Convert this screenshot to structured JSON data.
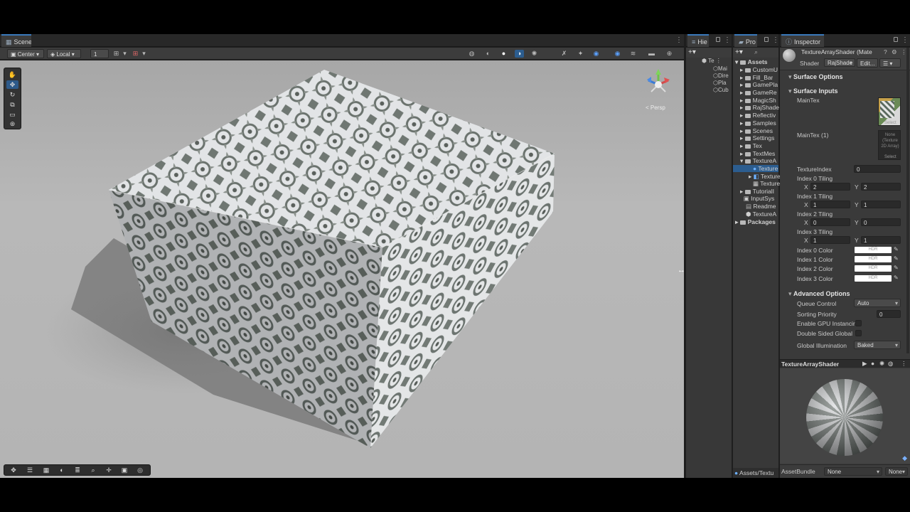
{
  "scene": {
    "tab": "Scene",
    "pivot_mode": "Center",
    "pivot_rotation": "Local",
    "grid_value": "1",
    "persp_label": "< Persp"
  },
  "hierarchy": {
    "tab": "Hie",
    "scene_name": "Te",
    "items": [
      "Mai",
      "Dire",
      "Pla",
      "Cub"
    ]
  },
  "project": {
    "tab": "Pro",
    "assets_label": "Assets",
    "folders": [
      "CustomU",
      "Fill_Bar",
      "GamePla",
      "GameRe",
      "MagicSh",
      "RajShade",
      "Reflectiv",
      "Samples",
      "Scenes",
      "Settings",
      "Tex",
      "TextMes",
      "TextureA"
    ],
    "texture_children": [
      "Texture",
      "Texture",
      "Texture"
    ],
    "more_folders": [
      "TutorialI",
      "InputSys"
    ],
    "files": [
      "Readme",
      "TextureA"
    ],
    "packages_label": "Packages",
    "footer_path": "Assets/Textu"
  },
  "inspector": {
    "tab": "Inspector",
    "material_name": "TextureArrayShader (Mate",
    "shader_label": "Shader",
    "shader_value": "RajShade",
    "edit_button": "Edit...",
    "surface_options": "Surface Options",
    "surface_inputs": "Surface Inputs",
    "main_tex": "MainTex",
    "select_label": "Select",
    "main_tex_1": "MainTex (1)",
    "main_tex_1_slot": "None (Texture 2D Array)",
    "texture_index_label": "TextureIndex",
    "texture_index_value": "0",
    "tilings": [
      {
        "label": "Index 0 Tiling",
        "x": "2",
        "y": "2"
      },
      {
        "label": "Index 1 Tiling",
        "x": "1",
        "y": "1"
      },
      {
        "label": "Index 2 Tiling",
        "x": "0",
        "y": "0"
      },
      {
        "label": "Index 3 Tiling",
        "x": "1",
        "y": "1"
      }
    ],
    "x_label": "X",
    "y_label": "Y",
    "colors": [
      {
        "label": "Index 0 Color",
        "hdr": "HDR"
      },
      {
        "label": "Index 1 Color",
        "hdr": "HDR"
      },
      {
        "label": "Index 2 Color",
        "hdr": "HDR"
      },
      {
        "label": "Index 3 Color",
        "hdr": "HDR"
      }
    ],
    "advanced_options": "Advanced Options",
    "queue_control_label": "Queue Control",
    "queue_control_value": "Auto",
    "sorting_priority_label": "Sorting Priority",
    "sorting_priority_value": "0",
    "gpu_instancing_label": "Enable GPU Instancir",
    "double_sided_label": "Double Sided Global",
    "global_illumination_label": "Global Illumination",
    "global_illumination_value": "Baked",
    "preview_title": "TextureArrayShader",
    "asset_bundle_label": "AssetBundle",
    "asset_bundle_value": "None",
    "asset_variant_value": "None"
  },
  "colors": {
    "accent": "#3a79bb",
    "tile_light": "#e2e4e6",
    "tile_dark": "#6a726d"
  }
}
